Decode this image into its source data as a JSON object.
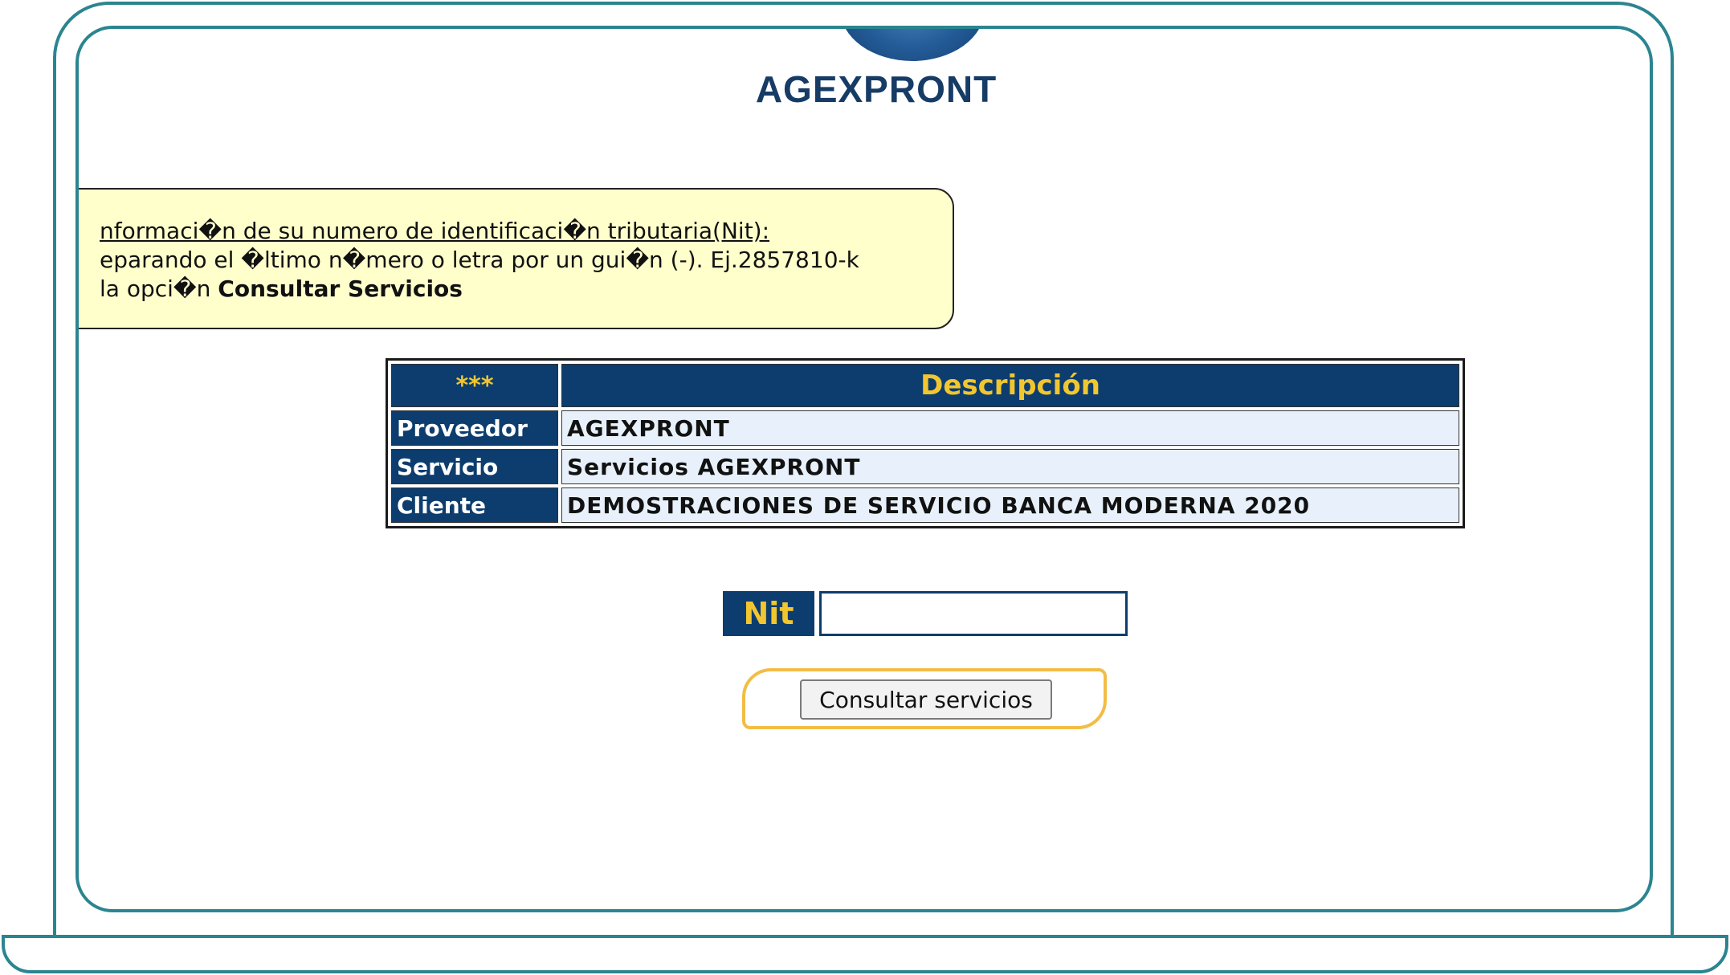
{
  "logo": {
    "text": "AGEXPRONT"
  },
  "info_box": {
    "line1": "nformaci�n de su numero de identificaci�n tributaria(Nit):",
    "line2": "eparando el �ltimo n�mero o letra por un gui�n (-). Ej.2857810-k",
    "line3_prefix": " la opci�n ",
    "line3_bold": "Consultar Servicios"
  },
  "table": {
    "header_stars": "***",
    "header_description": "Descripción",
    "rows": [
      {
        "label": "Proveedor",
        "value": "AGEXPRONT"
      },
      {
        "label": "Servicio",
        "value": "Servicios AGEXPRONT"
      },
      {
        "label": "Cliente",
        "value": "DEMOSTRACIONES DE SERVICIO BANCA MODERNA 2020"
      }
    ]
  },
  "form": {
    "nit_label": "Nit",
    "nit_value": "",
    "submit_label": "Consultar servicios"
  },
  "colors": {
    "frame": "#2b8590",
    "navy": "#0d3d6e",
    "gold": "#f2c62f",
    "info_bg": "#ffffcc",
    "highlight": "#f2bd46"
  }
}
